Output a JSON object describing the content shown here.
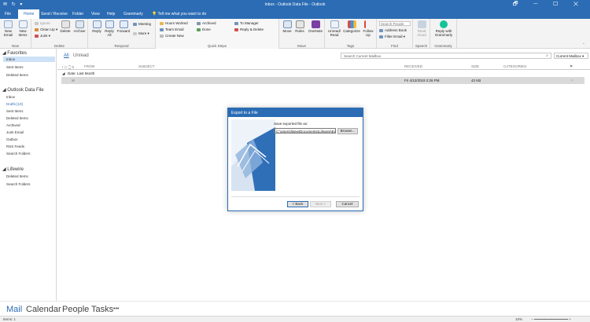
{
  "window": {
    "title": "Inbox - Outlook Data File - Outlook",
    "quick_access": "✉ ↻ ▾",
    "controls": "🗗 ─ ☐ ✕"
  },
  "ribbon_tabs": [
    "File",
    "Home",
    "Send / Receive",
    "Folder",
    "View",
    "Help",
    "Grammarly"
  ],
  "tell_me": "Tell me what you want to do",
  "ribbon": {
    "new": {
      "new_email": "New Email",
      "new_items": "New Items",
      "label": "New"
    },
    "delete": {
      "ignore": "Ignore",
      "clean_up": "Clean Up",
      "junk": "Junk",
      "delete": "Delete",
      "archive": "Archive",
      "label": "Delete"
    },
    "respond": {
      "reply": "Reply",
      "reply_all": "Reply All",
      "forward": "Forward",
      "meeting": "Meeting",
      "more": "More",
      "label": "Respond"
    },
    "quick_steps": {
      "items": [
        "Hours Worked",
        "Team Email",
        "Create New",
        "Archived",
        "Done",
        "To Manager",
        "Reply & Delete"
      ],
      "label": "Quick Steps"
    },
    "move": {
      "move": "Move",
      "rules": "Rules",
      "onenote": "OneNote",
      "label": "Move"
    },
    "tags": {
      "unread_read": "Unread/ Read",
      "categorize": "Categorize",
      "follow_up": "Follow Up",
      "label": "Tags"
    },
    "find": {
      "search_people": "Search People",
      "address_book": "Address Book",
      "filter_email": "Filter Email",
      "label": "Find"
    },
    "speech": {
      "read_aloud": "Read Aloud",
      "label": "Speech"
    },
    "grammarly": {
      "reply": "Reply with Grammarly",
      "label": "Grammarly"
    }
  },
  "folders": {
    "favorites_header": "Favorites",
    "favorites": [
      "Inbox",
      "Sent Items",
      "Deleted Items"
    ],
    "data_file_header": "Outlook Data File",
    "data_file": [
      "Inbox",
      "Drafts [10]",
      "Sent Items",
      "Deleted Items",
      "Archived",
      "Junk Email",
      "Outbox",
      "RSS Feeds",
      "Search Folders"
    ],
    "lifewire_header": "Lifewire",
    "lifewire": [
      "Deleted Items",
      "Search Folders"
    ]
  },
  "filter": {
    "all": "All",
    "unread": "Unread",
    "search_placeholder": "Search Current Mailbox",
    "scope": "Current Mailbox"
  },
  "list_headers": {
    "icons": "! ☖ 🗋 0",
    "from": "FROM",
    "subject": "SUBJECT",
    "received": "RECEIVED",
    "size": "SIZE",
    "categories": "CATEGORIES"
  },
  "group_label": "Date: Last Month",
  "mail_row": {
    "received": "Fri 4/12/2019 2:26 PM",
    "size": "42 KB"
  },
  "dialog": {
    "title": "Export to a File",
    "save_label": "Save exported file as:",
    "path": "C:\\Users\\lisew\\Documents\\Lifewire\\Ex",
    "browse": "Browse...",
    "back": "< Back",
    "next": "Next >",
    "cancel": "Cancel"
  },
  "nav": {
    "mail": "Mail",
    "calendar": "Calendar",
    "people": "People",
    "tasks": "Tasks",
    "more": "•••"
  },
  "status": {
    "items": "Items: 1",
    "zoom": "10%"
  },
  "colors": {
    "accent": "#2b6cb4",
    "selected": "#cde2f6"
  }
}
